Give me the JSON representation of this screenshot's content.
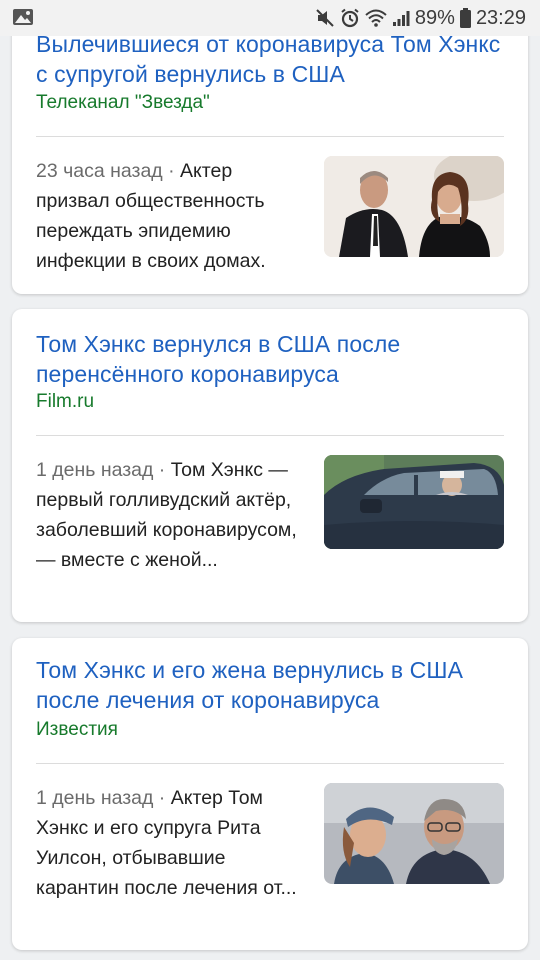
{
  "status_bar": {
    "battery_percent": "89%",
    "time": "23:29",
    "icons": [
      "image-icon",
      "mute-icon",
      "alarm-icon",
      "wifi-icon",
      "signal-icon",
      "battery-icon"
    ]
  },
  "articles": [
    {
      "title": "Вылечившиеся от коронавируса Том Хэнкс с супругой вернулись в США",
      "source": "Телеканал \"Звезда\"",
      "time": "23 часа назад",
      "separator": " · ",
      "snippet": "Актер призвал общественность переждать эпидемию инфекции в своих домах."
    },
    {
      "title": "Том Хэнкс вернулся в США после перенсённого коронавируса",
      "source": "Film.ru",
      "time": "1 день назад",
      "separator": " · ",
      "snippet": "Том Хэнкс — первый голливудский актёр, заболевший коронавирусом, — вместе с женой..."
    },
    {
      "title": "Том Хэнкс и его жена вернулись в США после лечения от коронавируса",
      "source": "Известия",
      "time": "1 день назад",
      "separator": " · ",
      "snippet": "Актер Том Хэнкс и его супруга Рита Уилсон, отбывавшие карантин после лечения от..."
    }
  ],
  "colors": {
    "title_link": "#1f61c0",
    "source_green": "#177a2c",
    "background": "#eef0f2"
  }
}
